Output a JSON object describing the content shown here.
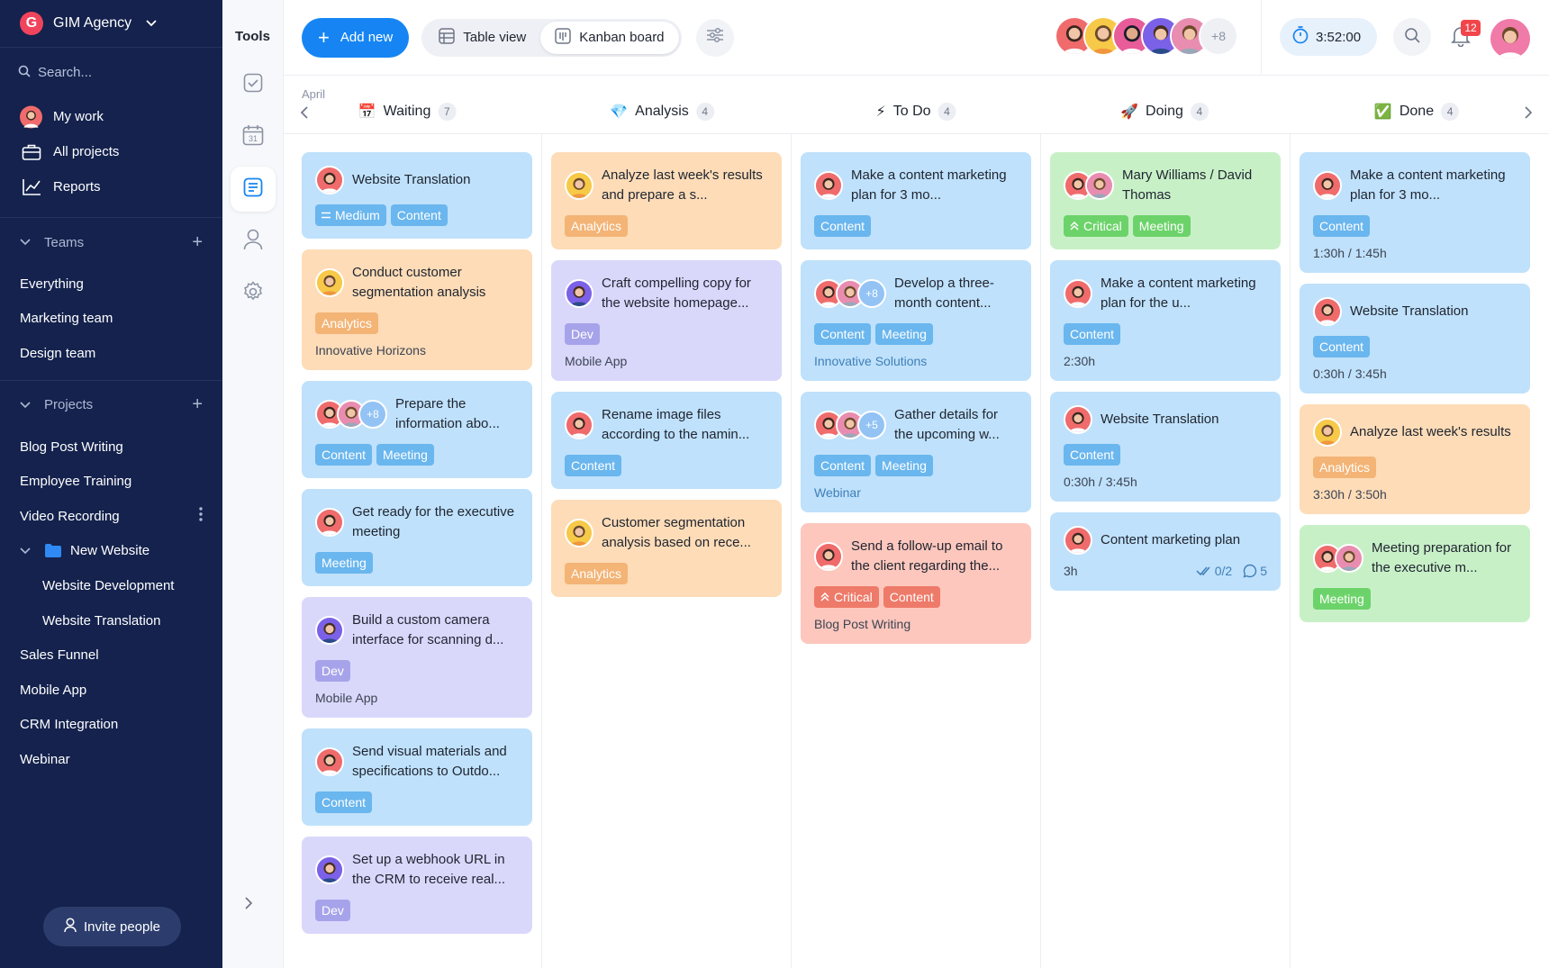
{
  "workspace": {
    "name": "GIM Agency",
    "logo_letter": "G"
  },
  "search": {
    "placeholder": "Search..."
  },
  "nav": [
    {
      "label": "My work",
      "icon": "user-avatar"
    },
    {
      "label": "All projects",
      "icon": "briefcase-icon"
    },
    {
      "label": "Reports",
      "icon": "chart-icon"
    }
  ],
  "teams": {
    "title": "Teams",
    "items": [
      "Everything",
      "Marketing team",
      "Design team"
    ]
  },
  "projects": {
    "title": "Projects",
    "items": [
      "Blog Post Writing",
      "Employee Training",
      "Video Recording"
    ],
    "folder": {
      "label": "New Website",
      "children": [
        "Website Development",
        "Website Translation"
      ]
    },
    "after": [
      "Sales Funnel",
      "Mobile App",
      "CRM Integration",
      "Webinar"
    ]
  },
  "invite_label": "Invite people",
  "tools_title": "Tools",
  "toolbar": {
    "add_label": "Add new",
    "table_view": "Table view",
    "kanban_board": "Kanban board",
    "team_more": "+8",
    "timer": "3:52:00",
    "notification_count": "12"
  },
  "board": {
    "month": "April",
    "columns": [
      {
        "name": "Waiting",
        "emoji": "📅",
        "count": "7"
      },
      {
        "name": "Analysis",
        "emoji": "💎",
        "count": "4"
      },
      {
        "name": "To Do",
        "emoji": "⚡",
        "count": "4"
      },
      {
        "name": "Doing",
        "emoji": "🚀",
        "count": "4"
      },
      {
        "name": "Done",
        "emoji": "✅",
        "count": "4"
      }
    ],
    "cards": [
      [
        {
          "title": "Website Translation",
          "tags": [
            "Medium",
            "Content"
          ]
        },
        {
          "title": "Conduct customer segmentation analysis",
          "tags": [
            "Analytics"
          ],
          "project": "Innovative Horizons"
        },
        {
          "title": "Prepare the information abo...",
          "tags": [
            "Content",
            "Meeting"
          ],
          "more": "+8"
        },
        {
          "title": "Get ready for the executive meeting",
          "tags": [
            "Meeting"
          ]
        },
        {
          "title": "Build a custom camera interface for scanning d...",
          "tags": [
            "Dev"
          ],
          "project": "Mobile App"
        },
        {
          "title": "Send visual materials and specifications to Outdo...",
          "tags": [
            "Content"
          ]
        },
        {
          "title": "Set up a webhook URL in the CRM to receive real...",
          "tags": [
            "Dev"
          ]
        }
      ],
      [
        {
          "title": "Analyze last week's results and prepare a s...",
          "tags": [
            "Analytics"
          ]
        },
        {
          "title": "Craft compelling copy for the website homepage...",
          "tags": [
            "Dev"
          ],
          "project": "Mobile App"
        },
        {
          "title": "Rename image files according to the namin...",
          "tags": [
            "Content"
          ]
        },
        {
          "title": "Customer segmentation analysis based on rece...",
          "tags": [
            "Analytics"
          ]
        }
      ],
      [
        {
          "title": "Make a content marketing plan for 3 mo...",
          "tags": [
            "Content"
          ]
        },
        {
          "title": "Develop a three-month content...",
          "tags": [
            "Content",
            "Meeting"
          ],
          "project": "Innovative Solutions",
          "more": "+8"
        },
        {
          "title": "Gather details for the upcoming w...",
          "tags": [
            "Content",
            "Meeting"
          ],
          "project": "Webinar",
          "more": "+5"
        },
        {
          "title": "Send a follow-up email to the client regarding the...",
          "tags": [
            "Critical",
            "Content"
          ],
          "project": "Blog Post Writing"
        }
      ],
      [
        {
          "title": "Mary Williams / David Thomas",
          "tags": [
            "Critical",
            "Meeting"
          ]
        },
        {
          "title": "Make a content marketing plan for the u...",
          "tags": [
            "Content"
          ],
          "time": "2:30h"
        },
        {
          "title": "Website Translation",
          "tags": [
            "Content"
          ],
          "time": "0:30h / 3:45h"
        },
        {
          "title": "Content marketing plan",
          "time": "3h",
          "checklist": "0/2",
          "comments": "5"
        }
      ],
      [
        {
          "title": "Make a content marketing plan for 3 mo...",
          "tags": [
            "Content"
          ],
          "time": "1:30h / 1:45h"
        },
        {
          "title": "Website Translation",
          "tags": [
            "Content"
          ],
          "time": "0:30h / 3:45h"
        },
        {
          "title": "Analyze last week's results",
          "tags": [
            "Analytics"
          ],
          "time": "3:30h / 3:50h"
        },
        {
          "title": "Meeting preparation for the executive m...",
          "tags": [
            "Meeting"
          ]
        }
      ]
    ]
  },
  "colors": {
    "sidebar": "#14224d",
    "accent": "#1685f3",
    "card_blue": "#bfe1fb",
    "card_orange": "#fddcb7",
    "card_purple": "#d9d8fb",
    "card_green": "#c8f0c7",
    "card_red": "#fdc7bd"
  }
}
